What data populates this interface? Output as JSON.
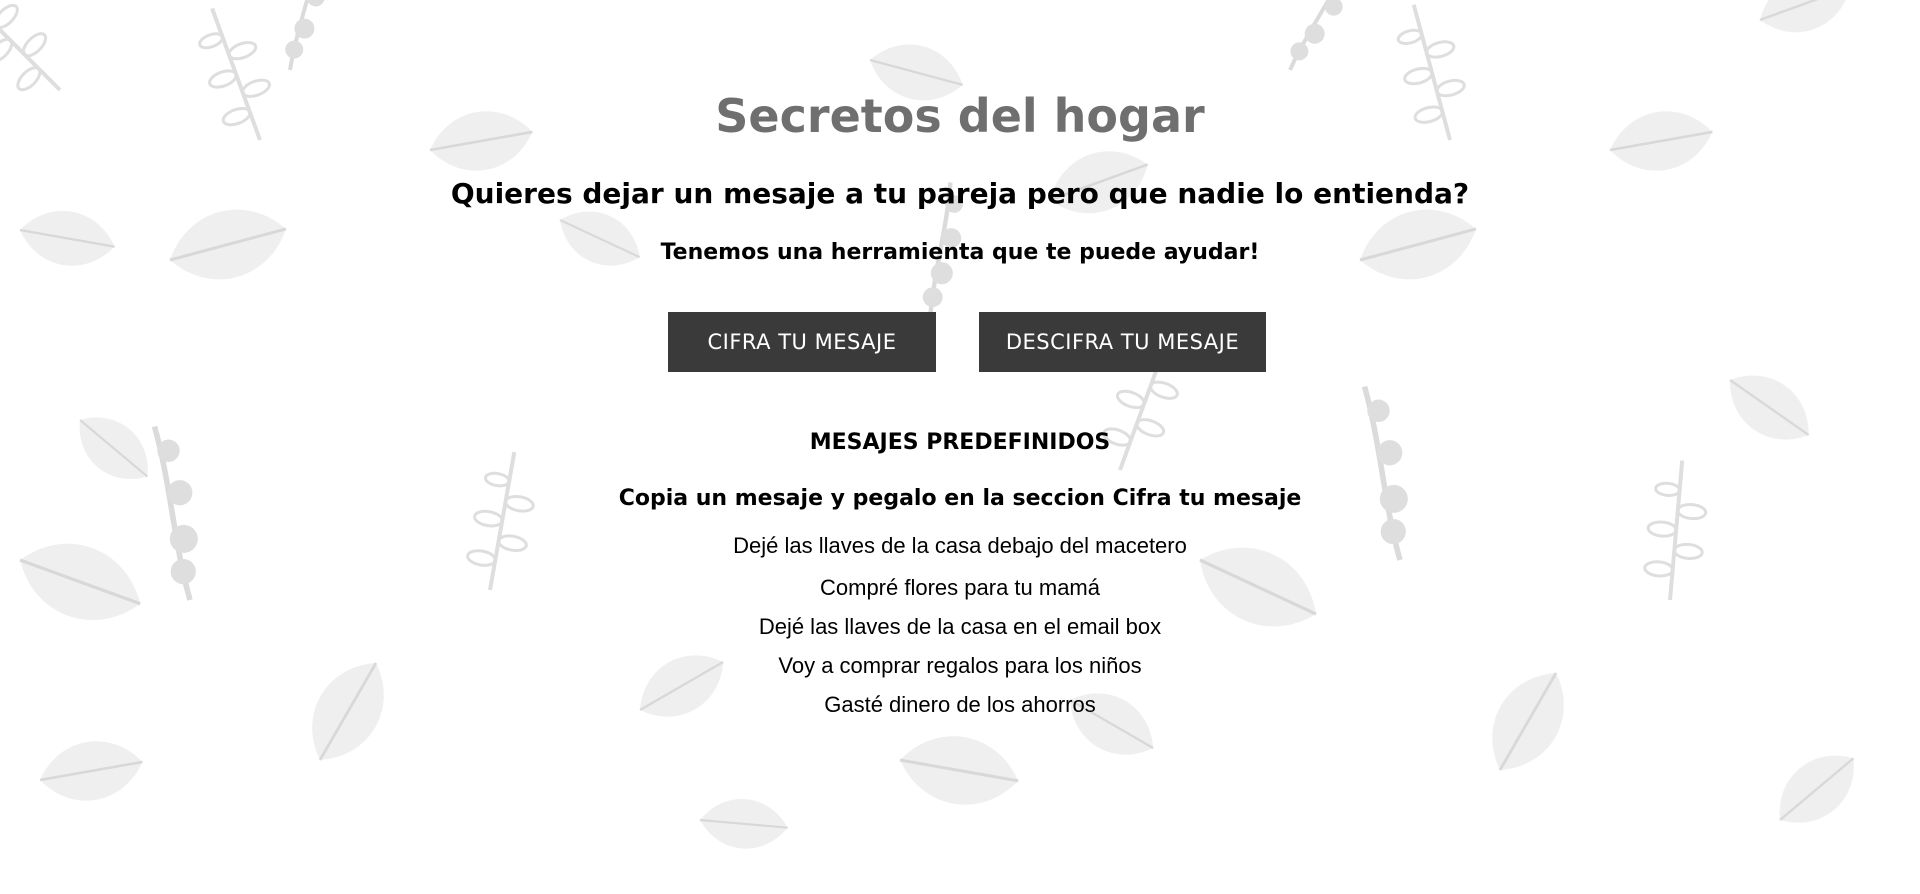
{
  "page": {
    "title": "Secretos del hogar",
    "subtitle": "Quieres dejar un mesaje a tu pareja pero que nadie lo entienda?",
    "tagline": "Tenemos una herramienta que te puede ayudar!"
  },
  "actions": {
    "cipher_label": "CIFRA TU MESAJE",
    "decipher_label": "DESCIFRA TU MESAJE"
  },
  "predefined": {
    "heading": "MESAJES PREDEFINIDOS",
    "instructions": "Copia un mesaje y pegalo en la seccion Cifra tu mesaje",
    "messages": [
      "Dejé las llaves de la casa debajo del macetero",
      "Compré flores para tu mamá",
      "Dejé las llaves de la casa en el email box",
      "Voy a comprar regalos para los niños",
      "Gasté dinero de los ahorros"
    ]
  },
  "colors": {
    "title": "#6f6f6f",
    "button_bg": "#3a3a3a",
    "button_text": "#ffffff",
    "text": "#000000",
    "background": "#ffffff",
    "pattern": "#dcdcdc"
  },
  "icons": {
    "background": "floral-leaf-pattern"
  }
}
